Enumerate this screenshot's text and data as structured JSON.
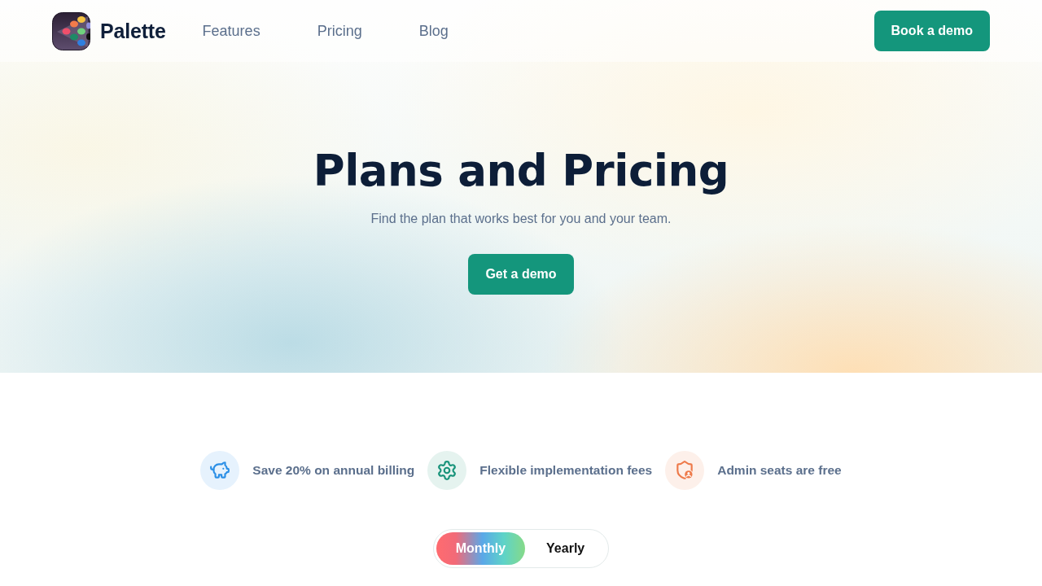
{
  "header": {
    "brand": "Palette",
    "nav": [
      {
        "label": "Features"
      },
      {
        "label": "Pricing"
      },
      {
        "label": "Blog"
      }
    ],
    "cta": "Book a demo"
  },
  "hero": {
    "title": "Plans and Pricing",
    "subtitle": "Find the plan that works best for you and your team.",
    "cta": "Get a demo"
  },
  "benefits": [
    {
      "kind": "piggy",
      "text": "Save 20% on annual billing"
    },
    {
      "kind": "gear",
      "text": "Flexible implementation fees"
    },
    {
      "kind": "shield",
      "text": "Admin seats are free"
    }
  ],
  "billing_toggle": [
    {
      "label": "Monthly",
      "selected": true
    },
    {
      "label": "Yearly",
      "selected": false
    }
  ]
}
